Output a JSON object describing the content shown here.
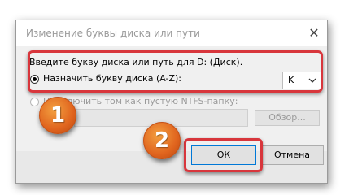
{
  "dialog": {
    "title": "Изменение буквы диска или пути",
    "prompt": "Введите букву диска или путь для D: (Диск).",
    "option_assign_letter": "Назначить букву диска (A-Z):",
    "option_mount_folder": "Подключить том как пустую NTFS-папку:",
    "drive_letter": "K",
    "browse_label": "Обзор...",
    "ok_label": "ОК",
    "cancel_label": "Отмена",
    "close_glyph": "✕"
  },
  "annotations": {
    "badge_1": "1",
    "badge_2": "2",
    "highlight_color": "#d8363c",
    "badge_color": "#e0641e"
  }
}
